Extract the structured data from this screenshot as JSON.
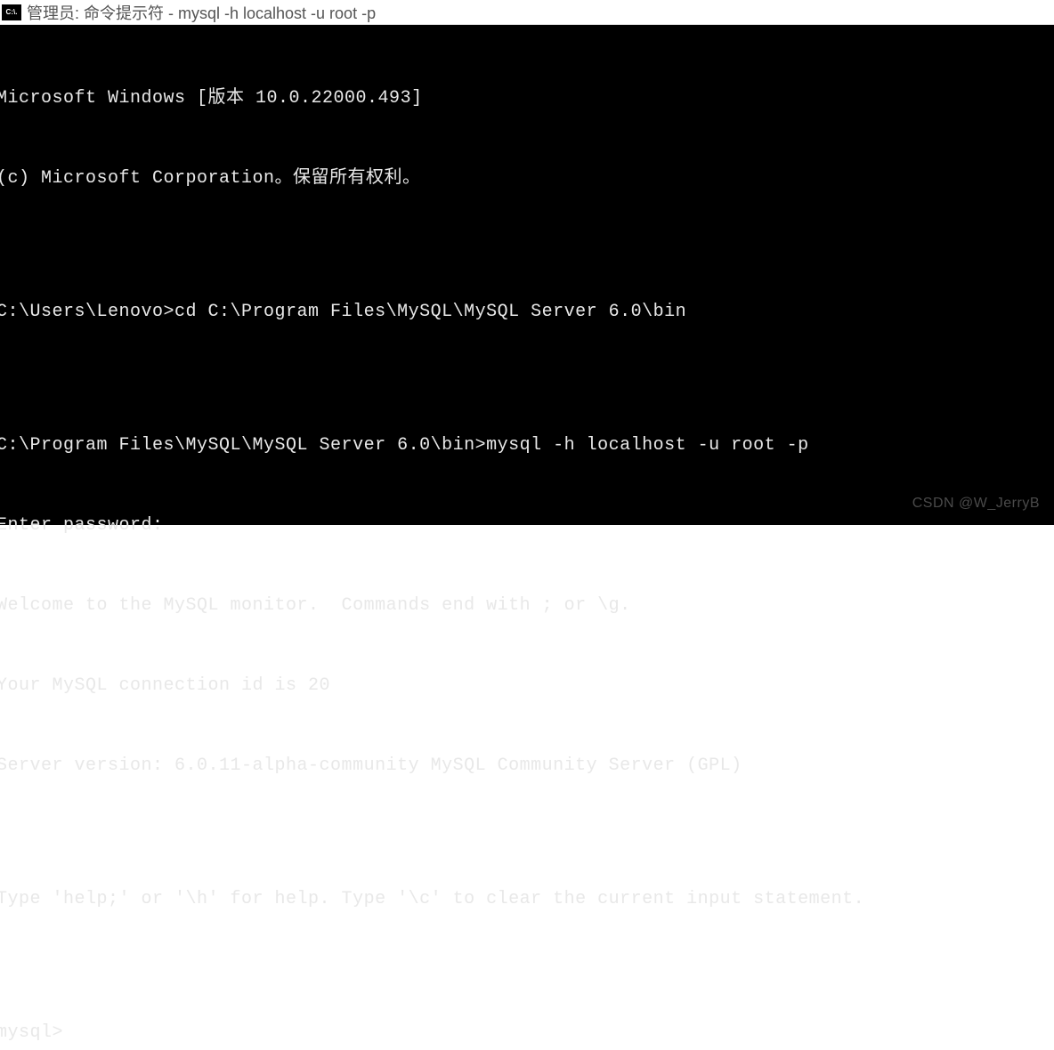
{
  "titlebar": {
    "icon_text": "C:\\.",
    "title": "管理员: 命令提示符 - mysql  -h localhost -u root -p"
  },
  "terminal": {
    "lines": [
      "Microsoft Windows [版本 10.0.22000.493]",
      "(c) Microsoft Corporation。保留所有权利。",
      "",
      "C:\\Users\\Lenovo>cd C:\\Program Files\\MySQL\\MySQL Server 6.0\\bin",
      "",
      "C:\\Program Files\\MySQL\\MySQL Server 6.0\\bin>mysql -h localhost -u root -p",
      "Enter password:",
      "Welcome to the MySQL monitor.  Commands end with ; or \\g.",
      "Your MySQL connection id is 20",
      "Server version: 6.0.11-alpha-community MySQL Community Server (GPL)",
      "",
      "Type 'help;' or '\\h' for help. Type '\\c' to clear the current input statement.",
      "",
      "mysql>"
    ]
  },
  "watermark": {
    "text": "CSDN @W_JerryB"
  }
}
